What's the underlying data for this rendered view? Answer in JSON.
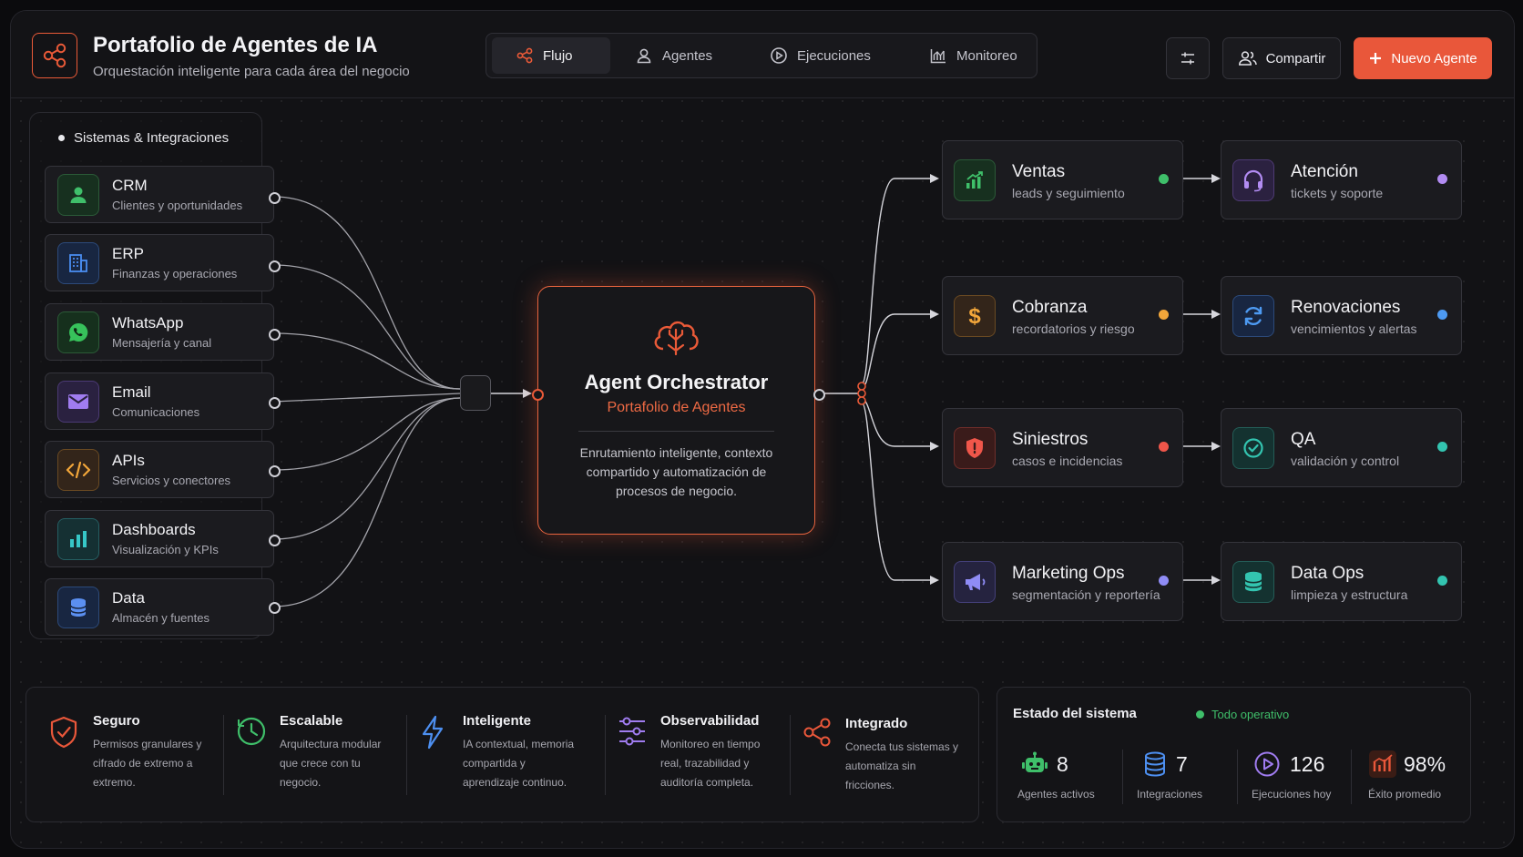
{
  "header": {
    "title": "Portafolio de Agentes de IA",
    "subtitle": "Orquestación inteligente para cada área del negocio",
    "tabs": [
      {
        "label": "Flujo",
        "icon": "flow-icon",
        "active": true
      },
      {
        "label": "Agentes",
        "icon": "user-icon",
        "active": false
      },
      {
        "label": "Ejecuciones",
        "icon": "play-icon",
        "active": false
      },
      {
        "label": "Monitoreo",
        "icon": "chart-icon",
        "active": false
      }
    ],
    "share_label": "Compartir",
    "new_agent_label": "Nuevo Agente"
  },
  "sources": {
    "label": "Sistemas & Integraciones",
    "items": [
      {
        "title": "CRM",
        "subtitle": "Clientes y oportunidades",
        "icon": "user-icon",
        "color": "#3fbf6a"
      },
      {
        "title": "ERP",
        "subtitle": "Finanzas y operaciones",
        "icon": "building-icon",
        "color": "#4a8cf0"
      },
      {
        "title": "WhatsApp",
        "subtitle": "Mensajería y canal",
        "icon": "whatsapp-icon",
        "color": "#37c25b"
      },
      {
        "title": "Email",
        "subtitle": "Comunicaciones",
        "icon": "mail-icon",
        "color": "#a07cf0"
      },
      {
        "title": "APIs",
        "subtitle": "Servicios y conectores",
        "icon": "code-icon",
        "color": "#f2a63a"
      },
      {
        "title": "Dashboards",
        "subtitle": "Visualización y KPIs",
        "icon": "bar-chart-icon",
        "color": "#36c7c7"
      },
      {
        "title": "Data",
        "subtitle": "Almacén y fuentes",
        "icon": "database-icon",
        "color": "#5b8ff0"
      }
    ]
  },
  "orchestrator": {
    "title": "Agent Orchestrator",
    "subtitle": "Portafolio de Agentes",
    "description": "Enrutamiento inteligente, contexto compartido y automatización de procesos de negocio."
  },
  "agents": {
    "left": [
      {
        "title": "Ventas",
        "subtitle": "leads y seguimiento",
        "icon": "trend-up-icon",
        "color": "#3fbf6a"
      },
      {
        "title": "Cobranza",
        "subtitle": "recordatorios y riesgo",
        "icon": "dollar-icon",
        "color": "#f2a63a"
      },
      {
        "title": "Siniestros",
        "subtitle": "casos e incidencias",
        "icon": "shield-icon",
        "color": "#f0564a"
      },
      {
        "title": "Marketing Ops",
        "subtitle": "segmentación y reportería",
        "icon": "megaphone-icon",
        "color": "#8f8cf5"
      }
    ],
    "right": [
      {
        "title": "Atención",
        "subtitle": "tickets y soporte",
        "icon": "headset-icon",
        "color": "#b28cf2"
      },
      {
        "title": "Renovaciones",
        "subtitle": "vencimientos y alertas",
        "icon": "refresh-icon",
        "color": "#4d9af2"
      },
      {
        "title": "QA",
        "subtitle": "validación y control",
        "icon": "check-circle-icon",
        "color": "#33c4b0"
      },
      {
        "title": "Data Ops",
        "subtitle": "limpieza y estructura",
        "icon": "database-icon",
        "color": "#33c4b0"
      }
    ]
  },
  "features": [
    {
      "title": "Seguro",
      "desc": "Permisos granulares y cifrado de extremo a extremo.",
      "icon": "shield-check-icon",
      "color": "#e9573a"
    },
    {
      "title": "Escalable",
      "desc": "Arquitectura modular que crece con tu negocio.",
      "icon": "clock-icon",
      "color": "#3fbf6a"
    },
    {
      "title": "Inteligente",
      "desc": "IA contextual, memoria compartida y aprendizaje continuo.",
      "icon": "bolt-icon",
      "color": "#4d8ff0"
    },
    {
      "title": "Observabilidad",
      "desc": "Monitoreo en tiempo real, trazabilidad y auditoría completa.",
      "icon": "sliders-icon",
      "color": "#a07cf0"
    },
    {
      "title": "Integrado",
      "desc": "Conecta tus sistemas y automatiza sin fricciones.",
      "icon": "share-icon",
      "color": "#e9573a"
    }
  ],
  "system_status": {
    "title": "Estado del sistema",
    "status": "Todo operativo",
    "status_color": "#3fbf6a",
    "stats": [
      {
        "value": "8",
        "label": "Agentes activos",
        "icon": "robot-icon",
        "color": "#3fbf6a"
      },
      {
        "value": "7",
        "label": "Integraciones",
        "icon": "database-icon",
        "color": "#4d8ff0"
      },
      {
        "value": "126",
        "label": "Ejecuciones hoy",
        "icon": "play-icon",
        "color": "#a07cf0"
      },
      {
        "value": "98%",
        "label": "Éxito promedio",
        "icon": "chart-icon",
        "color": "#e9573a"
      }
    ]
  },
  "colors": {
    "accent": "#e9573a"
  }
}
